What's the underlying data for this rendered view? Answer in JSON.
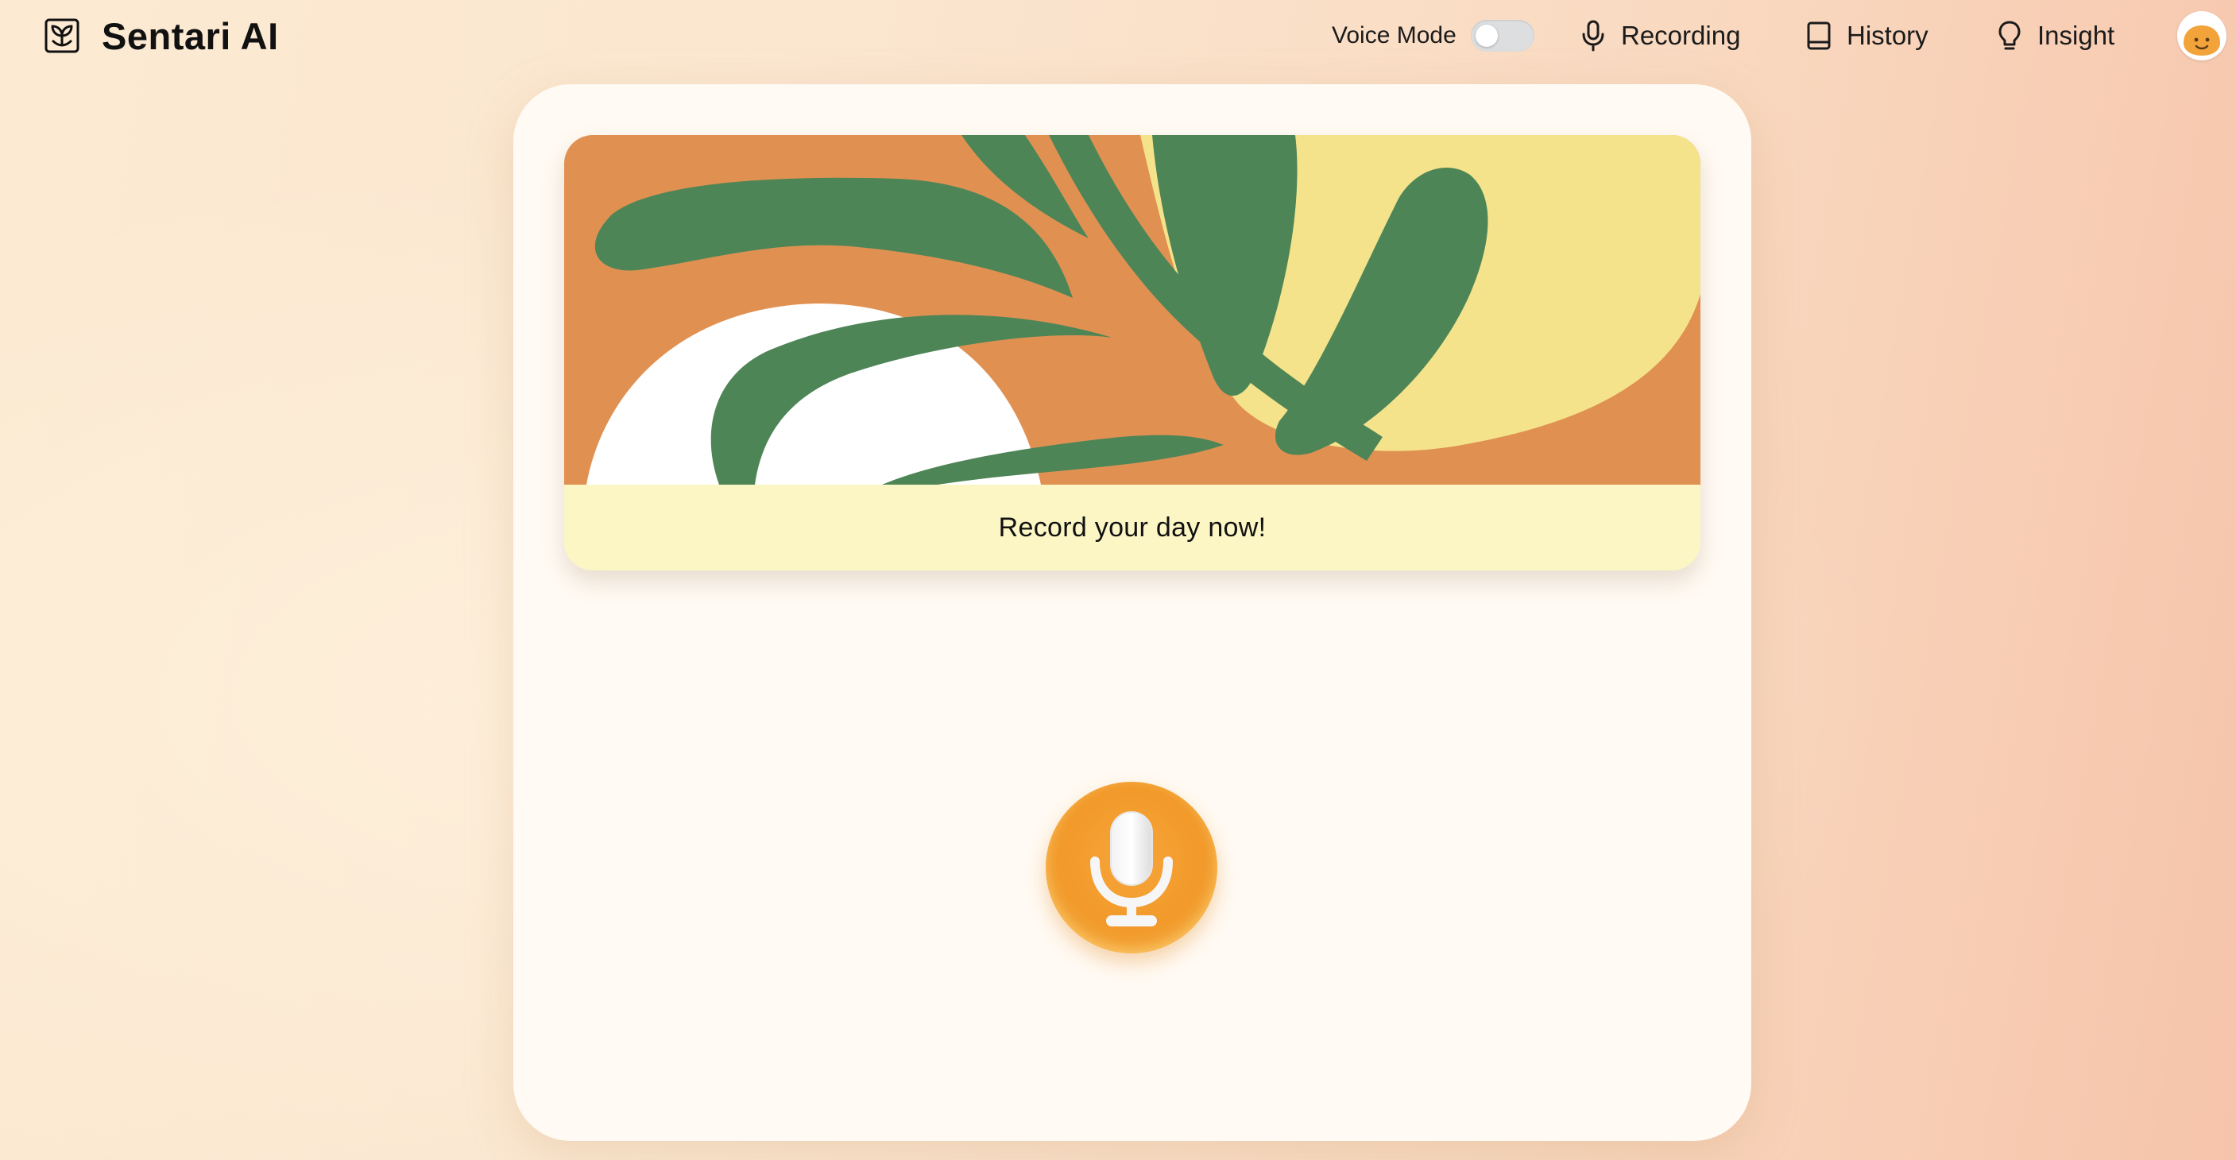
{
  "app": {
    "title": "Sentari AI",
    "logo_icon": "leaf-book-icon"
  },
  "header": {
    "voice_mode": {
      "label": "Voice Mode",
      "enabled": false
    },
    "nav": [
      {
        "label": "Recording",
        "icon": "microphone-icon"
      },
      {
        "label": "History",
        "icon": "book-icon"
      },
      {
        "label": "Insight",
        "icon": "lightbulb-icon"
      }
    ],
    "avatar_icon": "smiley-avatar-icon"
  },
  "main": {
    "banner": {
      "caption": "Record your day now!",
      "art": "abstract-leaf-illustration"
    },
    "record_button": {
      "icon": "microphone-icon"
    }
  },
  "colors": {
    "accent": "#f29a2b",
    "banner_orange": "#e09152",
    "banner_green": "#4e8556",
    "banner_yellow": "#f5e38c",
    "caption_bg": "#fcf6c5",
    "card_bg": "#fffaf3"
  }
}
